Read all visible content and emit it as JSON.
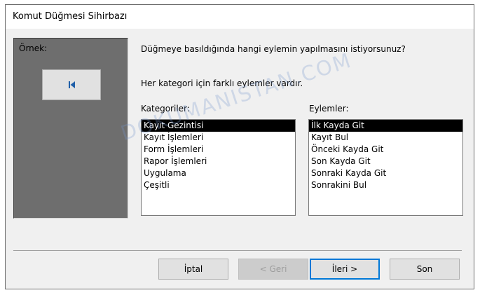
{
  "window": {
    "title": "Komut Düğmesi Sihirbazı"
  },
  "preview": {
    "label": "Örnek:",
    "button_icon": "first-record-icon"
  },
  "question": "Düğmeye basıldığında hangi eylemin yapılmasını istiyorsunuz?",
  "info": "Her kategori için farklı eylemler vardır.",
  "categories": {
    "label": "Kategoriler:",
    "items": [
      "Kayıt Gezintisi",
      "Kayıt İşlemleri",
      "Form İşlemleri",
      "Rapor İşlemleri",
      "Uygulama",
      "Çeşitli"
    ],
    "selected": "Kayıt Gezintisi"
  },
  "actions": {
    "label": "Eylemler:",
    "items": [
      "İlk Kayda Git",
      "Kayıt Bul",
      "Önceki Kayda Git",
      "Son Kayda Git",
      "Sonraki Kayda Git",
      "Sonrakini Bul"
    ],
    "selected": "İlk Kayda Git"
  },
  "buttons": {
    "cancel": "İptal",
    "back": "< Geri",
    "next": "İleri >",
    "finish": "Son"
  },
  "watermark": "DOKUMANISTAN.COM"
}
